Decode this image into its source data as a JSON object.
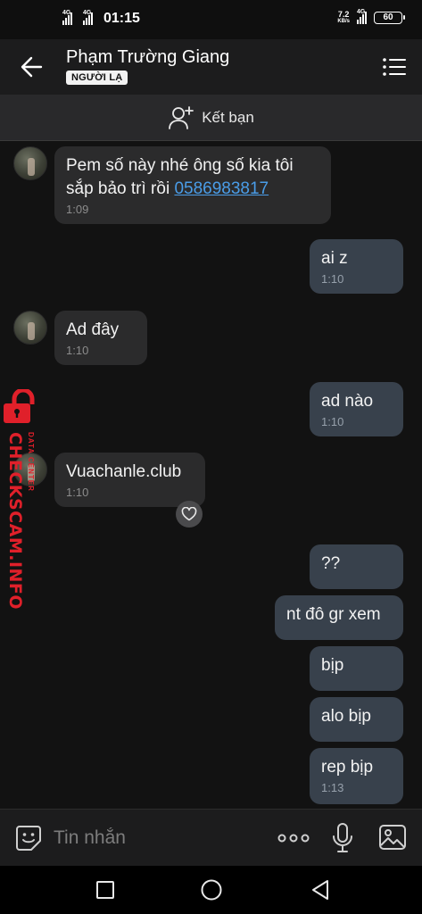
{
  "status_bar": {
    "time": "01:15",
    "net_left_1": "4G",
    "net_left_2": "4G",
    "speed_value": "7.2",
    "speed_unit": "KB/s",
    "net_right": "4G",
    "battery": "60"
  },
  "header": {
    "contact_name": "Phạm Trường Giang",
    "badge": "NGƯỜI LẠ",
    "back_icon": "arrow-left-icon",
    "menu_icon": "list-menu-icon"
  },
  "add_friend": {
    "label": "Kết bạn",
    "icon": "add-user-icon"
  },
  "messages": [
    {
      "dir": "in",
      "text": "Pem số này nhé ông số kia tôi sắp bảo trì rồi",
      "link": "0586983817",
      "time": "1:09"
    },
    {
      "dir": "out",
      "text": "ai z",
      "time": "1:10"
    },
    {
      "dir": "in",
      "text": "Ad đây",
      "time": "1:10"
    },
    {
      "dir": "out",
      "text": "ad nào",
      "time": "1:10"
    },
    {
      "dir": "in",
      "text": "Vuachanle.club",
      "time": "1:10",
      "reaction_icon": "heart-icon"
    },
    {
      "dir": "out",
      "text": "??"
    },
    {
      "dir": "out",
      "text": "nt đô gr xem"
    },
    {
      "dir": "out",
      "text": "bịp"
    },
    {
      "dir": "out",
      "text": "alo bịp"
    },
    {
      "dir": "out",
      "text": "rep bịp",
      "time": "1:13"
    }
  ],
  "watermark": {
    "main": "CHECKSCAM.INFO",
    "sub": "DATA CENTER"
  },
  "composer": {
    "placeholder": "Tin nhắn",
    "sticker_icon": "sticker-icon",
    "more_icon": "more-dots-icon",
    "mic_icon": "microphone-icon",
    "image_icon": "image-icon"
  },
  "nav_bar": {
    "recent_icon": "square-icon",
    "home_icon": "circle-icon",
    "back_icon": "triangle-back-icon"
  },
  "colors": {
    "incoming": "#2b2b2c",
    "outgoing": "#38414c",
    "link": "#4a9de8",
    "watermark": "#e0202a"
  }
}
